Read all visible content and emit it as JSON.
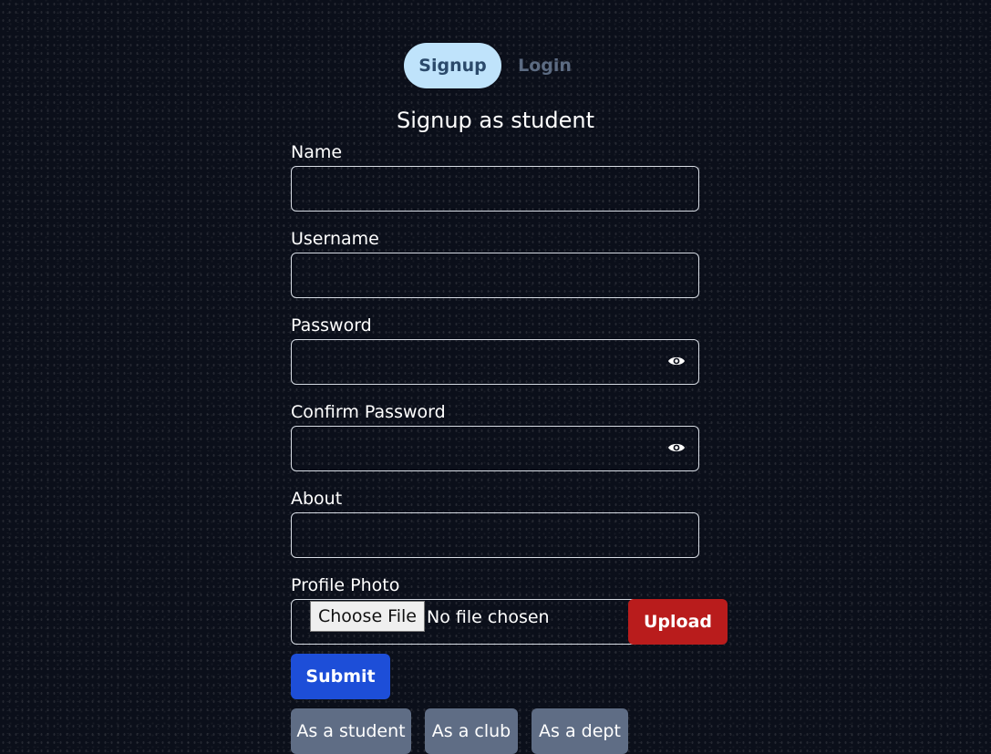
{
  "tabs": {
    "signup": "Signup",
    "login": "Login"
  },
  "form": {
    "title": "Signup as student",
    "fields": {
      "name": {
        "label": "Name",
        "value": ""
      },
      "username": {
        "label": "Username",
        "value": ""
      },
      "password": {
        "label": "Password",
        "value": "",
        "toggle_icon": "eye-icon"
      },
      "confirm_password": {
        "label": "Confirm Password",
        "value": "",
        "toggle_icon": "eye-icon"
      },
      "about": {
        "label": "About",
        "value": ""
      },
      "profile_photo": {
        "label": "Profile Photo",
        "choose_label": "Choose File",
        "status": "No file chosen"
      }
    },
    "upload_label": "Upload",
    "submit_label": "Submit"
  },
  "roles": [
    "As a student",
    "As a club",
    "As a dept"
  ],
  "colors": {
    "background": "#0b0f1a",
    "tab_active_bg": "#bfe3fb",
    "tab_active_text": "#2b4a6b",
    "tab_inactive_text": "#5c6b82",
    "upload": "#b91c1c",
    "submit": "#1d4ed8",
    "role_button": "#5f6d85"
  }
}
